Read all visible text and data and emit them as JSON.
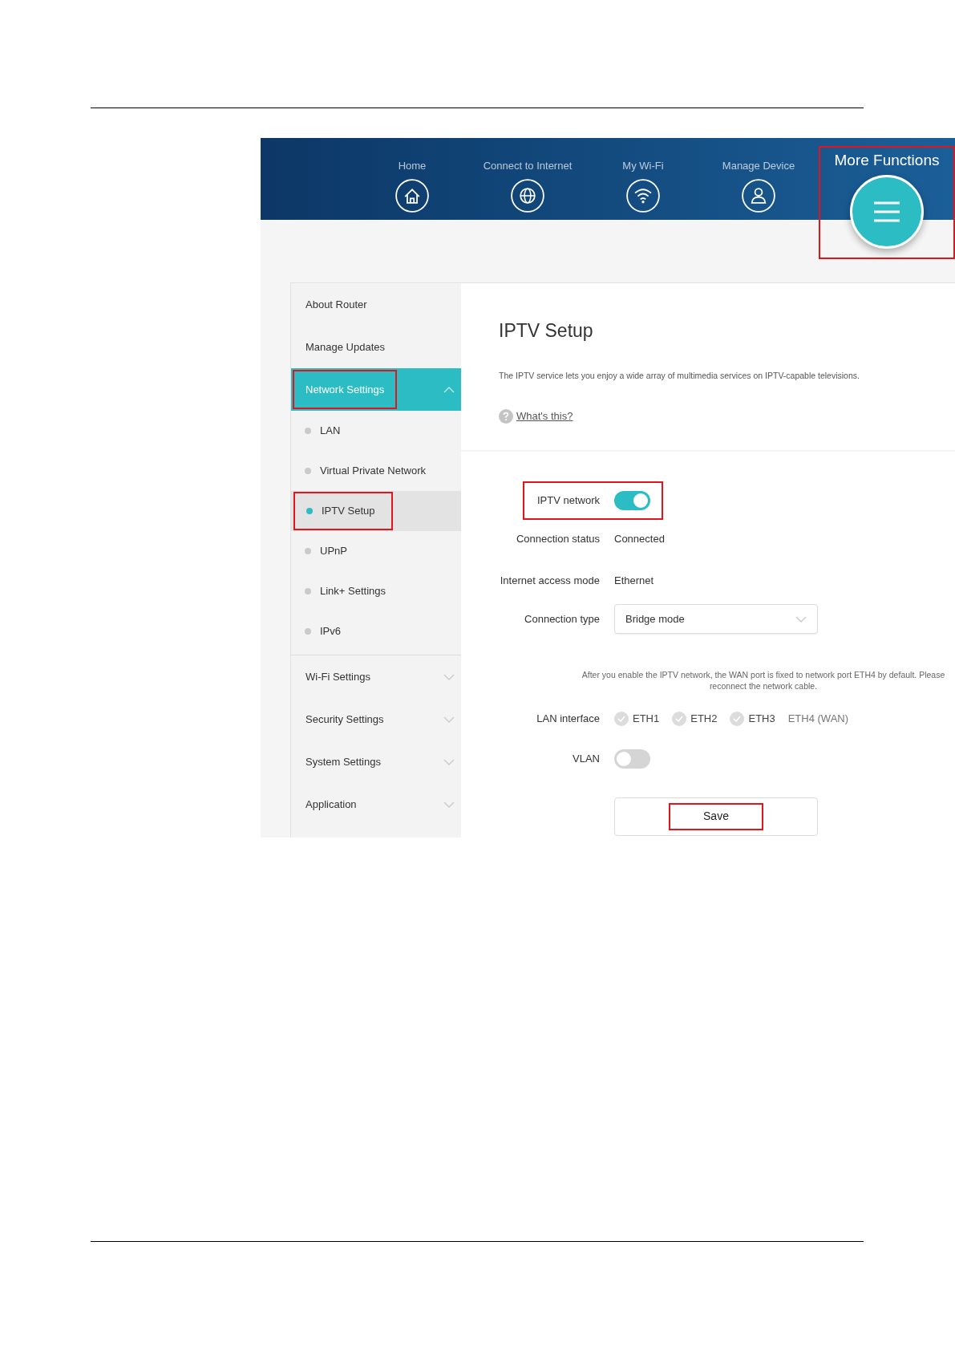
{
  "nav": [
    {
      "label": "Home"
    },
    {
      "label": "Connect to Internet"
    },
    {
      "label": "My Wi-Fi"
    },
    {
      "label": "Manage Device"
    }
  ],
  "more_functions": {
    "label": "More Functions",
    "highlighted": true
  },
  "sidebar": [
    {
      "label": "About Router",
      "kind": "item",
      "highlighted": false
    },
    {
      "label": "Manage Updates",
      "kind": "item",
      "highlighted": false
    },
    {
      "label": "Network Settings",
      "kind": "group",
      "expanded": true,
      "highlighted": true,
      "children": [
        {
          "label": "LAN",
          "selected": false,
          "highlighted": false
        },
        {
          "label": "Virtual Private Network",
          "selected": false,
          "highlighted": false
        },
        {
          "label": "IPTV Setup",
          "selected": true,
          "highlighted": true
        },
        {
          "label": "UPnP",
          "selected": false,
          "highlighted": false
        },
        {
          "label": "Link+ Settings",
          "selected": false,
          "highlighted": false
        },
        {
          "label": "IPv6",
          "selected": false,
          "highlighted": false
        }
      ]
    },
    {
      "label": "Wi-Fi Settings",
      "kind": "group",
      "expanded": false,
      "highlighted": false
    },
    {
      "label": "Security Settings",
      "kind": "group",
      "expanded": false,
      "highlighted": false
    },
    {
      "label": "System Settings",
      "kind": "group",
      "expanded": false,
      "highlighted": false
    },
    {
      "label": "Application",
      "kind": "group",
      "expanded": false,
      "highlighted": false
    }
  ],
  "content": {
    "title": "IPTV Setup",
    "description": "The IPTV service lets you enjoy a wide array of multimedia services on IPTV-capable televisions.",
    "help_link": "What's this?"
  },
  "form": {
    "iptv_network": {
      "label": "IPTV network",
      "on": true,
      "highlighted": true
    },
    "rows": [
      {
        "label": "Connection status",
        "value": "Connected"
      },
      {
        "label": "Internet access mode",
        "value": "Ethernet"
      }
    ],
    "connection_type": {
      "label": "Connection type",
      "value": "Bridge mode"
    },
    "note": "After you enable the IPTV network, the WAN port is fixed to network port ETH4 by default. Please\nreconnect the network cable.",
    "lan_interface": {
      "label": "LAN interface",
      "ports": [
        {
          "label": "ETH1",
          "kind": "checkbox",
          "checked": true
        },
        {
          "label": "ETH2",
          "kind": "checkbox",
          "checked": true
        },
        {
          "label": "ETH3",
          "kind": "checkbox",
          "checked": true
        },
        {
          "label": "ETH4 (WAN)",
          "kind": "text"
        }
      ]
    },
    "vlan": {
      "label": "VLAN",
      "on": false
    },
    "save": {
      "label": "Save",
      "highlighted": true
    }
  }
}
